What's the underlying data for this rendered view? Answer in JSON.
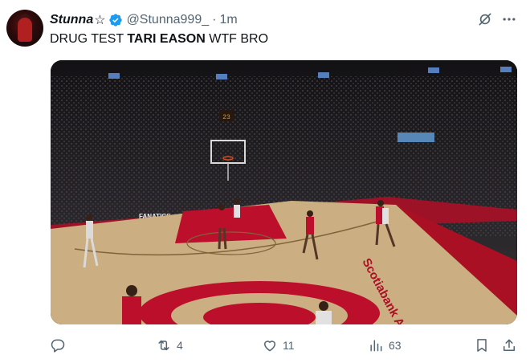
{
  "tweet": {
    "author_name": "Stunna",
    "author_suffix": "☆",
    "handle": "@Stunna999_",
    "separator": "·",
    "time": "1m",
    "text_before": "DRUG TEST ",
    "text_bold": "TARI EASON",
    "text_after": " WTF BRO"
  },
  "media": {
    "court_text": "Scotiabank Arena",
    "sign_text": "FANATICS",
    "shot_clock": "23"
  },
  "actions": {
    "retweets": "4",
    "likes": "11",
    "views": "63"
  },
  "colors": {
    "verified": "#1d9bf0",
    "text": "#0f1419",
    "secondary": "#536471",
    "court_red": "#c8102e"
  },
  "icons": [
    "verified-badge-icon",
    "grok-icon",
    "more-icon",
    "reply-icon",
    "retweet-icon",
    "like-icon",
    "views-icon",
    "bookmark-icon",
    "share-icon"
  ]
}
